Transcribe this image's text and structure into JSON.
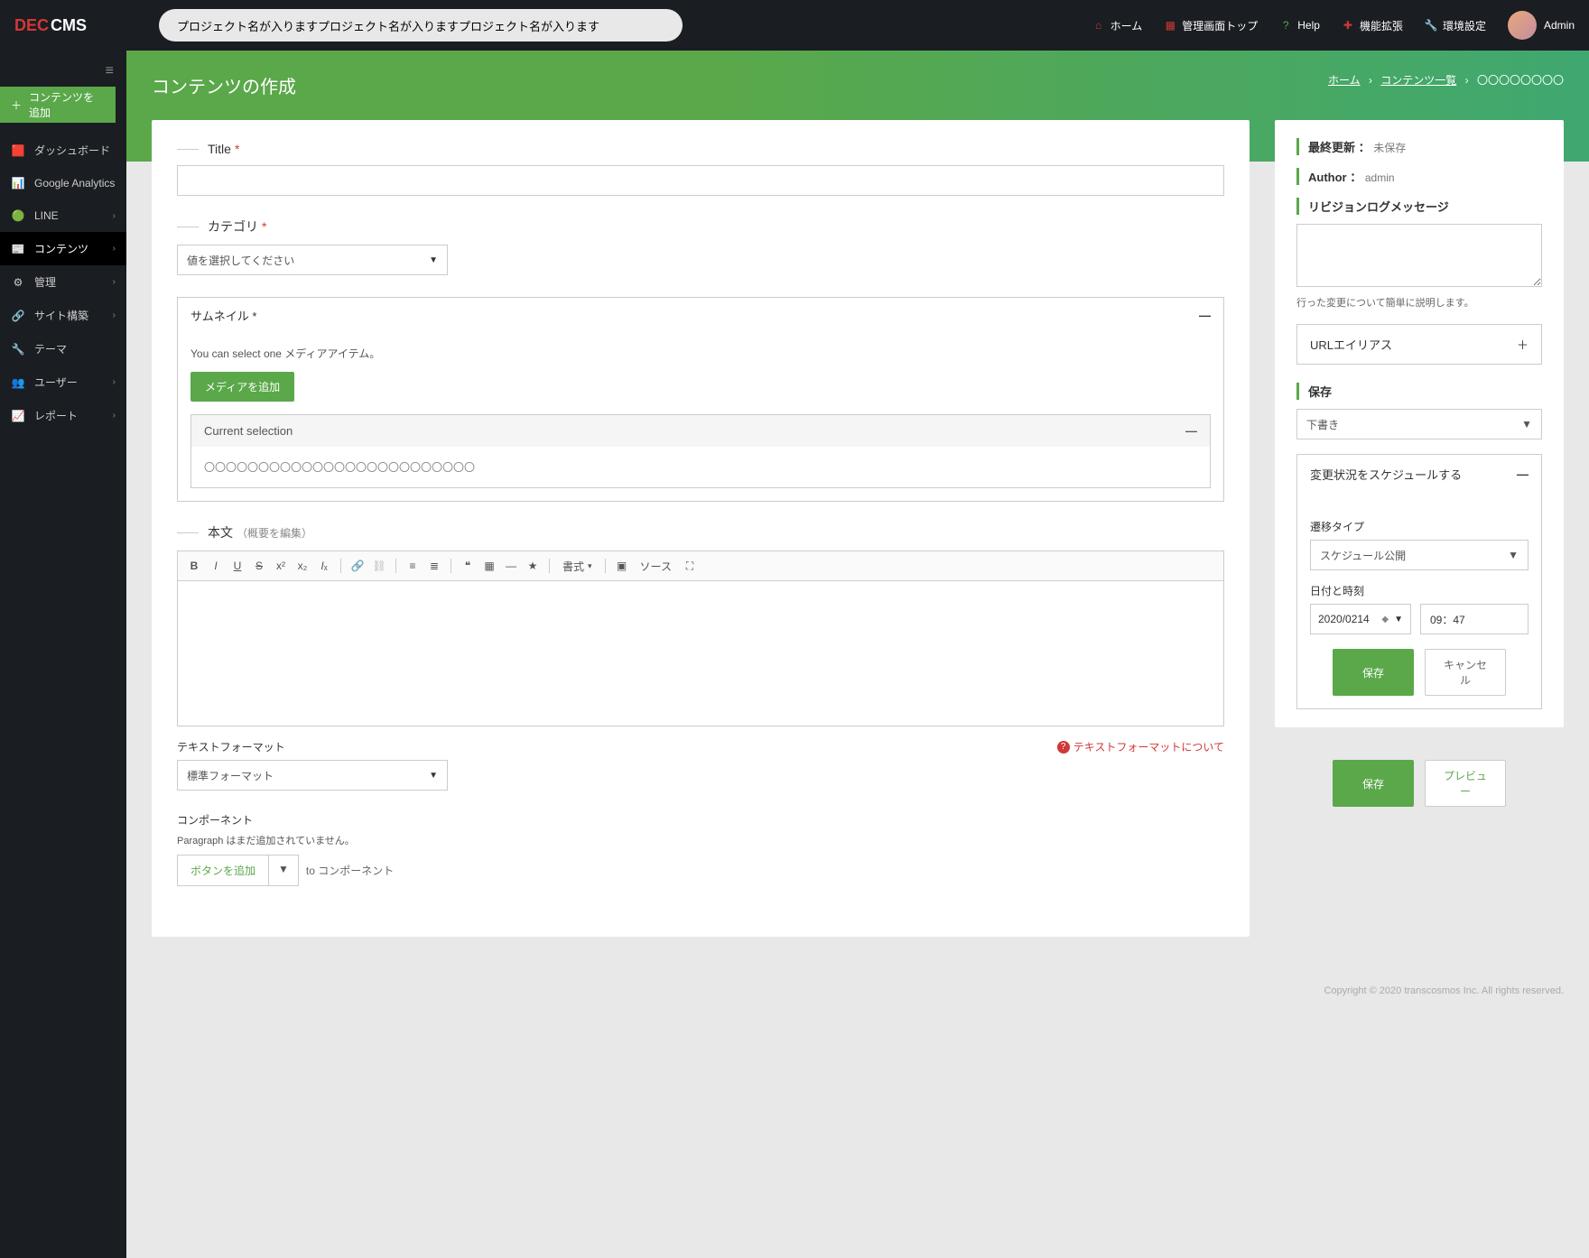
{
  "header": {
    "logo": {
      "dec": "DEC",
      "cms": "CMS"
    },
    "search_value": "プロジェクト名が入りますプロジェクト名が入りますプロジェクト名が入ります",
    "nav": {
      "home": "ホーム",
      "admin_top": "管理画面トップ",
      "help": "Help",
      "extend": "機能拡張",
      "settings": "環境設定"
    },
    "user": "Admin"
  },
  "sidebar": {
    "add_content": "コンテンツを追加",
    "items": [
      {
        "label": "ダッシュボード",
        "icon": "🟥",
        "expand": false
      },
      {
        "label": "Google Analytics",
        "icon": "📊",
        "expand": false
      },
      {
        "label": "LINE",
        "icon": "🟢",
        "expand": true
      },
      {
        "label": "コンテンツ",
        "icon": "📰",
        "expand": true,
        "active": true
      },
      {
        "label": "管理",
        "icon": "⚙",
        "expand": true
      },
      {
        "label": "サイト構築",
        "icon": "🔗",
        "expand": true
      },
      {
        "label": "テーマ",
        "icon": "🔧",
        "expand": false
      },
      {
        "label": "ユーザー",
        "icon": "👥",
        "expand": true
      },
      {
        "label": "レポート",
        "icon": "📈",
        "expand": true
      }
    ]
  },
  "banner": {
    "title": "コンテンツの作成",
    "crumbs": {
      "home": "ホーム",
      "list": "コンテンツ一覧",
      "current": "〇〇〇〇〇〇〇〇"
    }
  },
  "form": {
    "title_label": "Title",
    "category_label": "カテゴリ",
    "category_placeholder": "値を選択してください",
    "thumb_label": "サムネイル",
    "thumb_desc": "You can select one メディアアイテム。",
    "thumb_btn": "メディアを追加",
    "current_selection_label": "Current selection",
    "current_selection_value": "〇〇〇〇〇〇〇〇〇〇〇〇〇〇〇〇〇〇〇〇〇〇〇〇〇",
    "body_label": "本文",
    "body_sub": "（概要を編集）",
    "rte_format": "書式",
    "rte_source": "ソース",
    "text_format_label": "テキストフォーマット",
    "text_format_help": "テキストフォーマットについて",
    "text_format_value": "標準フォーマット",
    "component_label": "コンポーネント",
    "component_note": "Paragraph はまだ追加されていません。",
    "add_button": "ボタンを追加",
    "to_component": "to コンポーネント"
  },
  "side": {
    "last_updated_lbl": "最終更新 ：",
    "last_updated_val": "未保存",
    "author_lbl": "Author ：",
    "author_val": "admin",
    "revlog_label": "リビジョンログメッセージ",
    "revlog_hint": "行った変更について簡単に説明します。",
    "url_alias": "URLエイリアス",
    "save_label": "保存",
    "save_status": "下書き",
    "sched_label": "変更状況をスケジュールする",
    "transition_label": "遷移タイプ",
    "transition_value": "スケジュール公開",
    "datetime_label": "日付と時刻",
    "date_value": "2020/0214",
    "time_value": "09：47",
    "save_btn": "保存",
    "cancel_btn": "キャンセル",
    "bottom_save": "保存",
    "bottom_preview": "プレビュー"
  },
  "footer": "Copyright © 2020 transcosmos Inc. All rights reserved."
}
